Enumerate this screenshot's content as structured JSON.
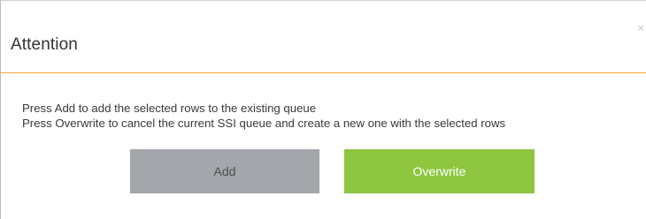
{
  "dialog": {
    "title": "Attention",
    "close_glyph": "×",
    "message_line_1": "Press Add to add the selected rows to the existing queue",
    "message_line_2": "Press Overwrite to cancel the current SSI queue and create a new one with the selected rows",
    "add_label": "Add",
    "overwrite_label": "Overwrite"
  },
  "colors": {
    "header_divider": "#f0a52e",
    "add_button": "#a3a6aa",
    "overwrite_button": "#8ec640"
  }
}
